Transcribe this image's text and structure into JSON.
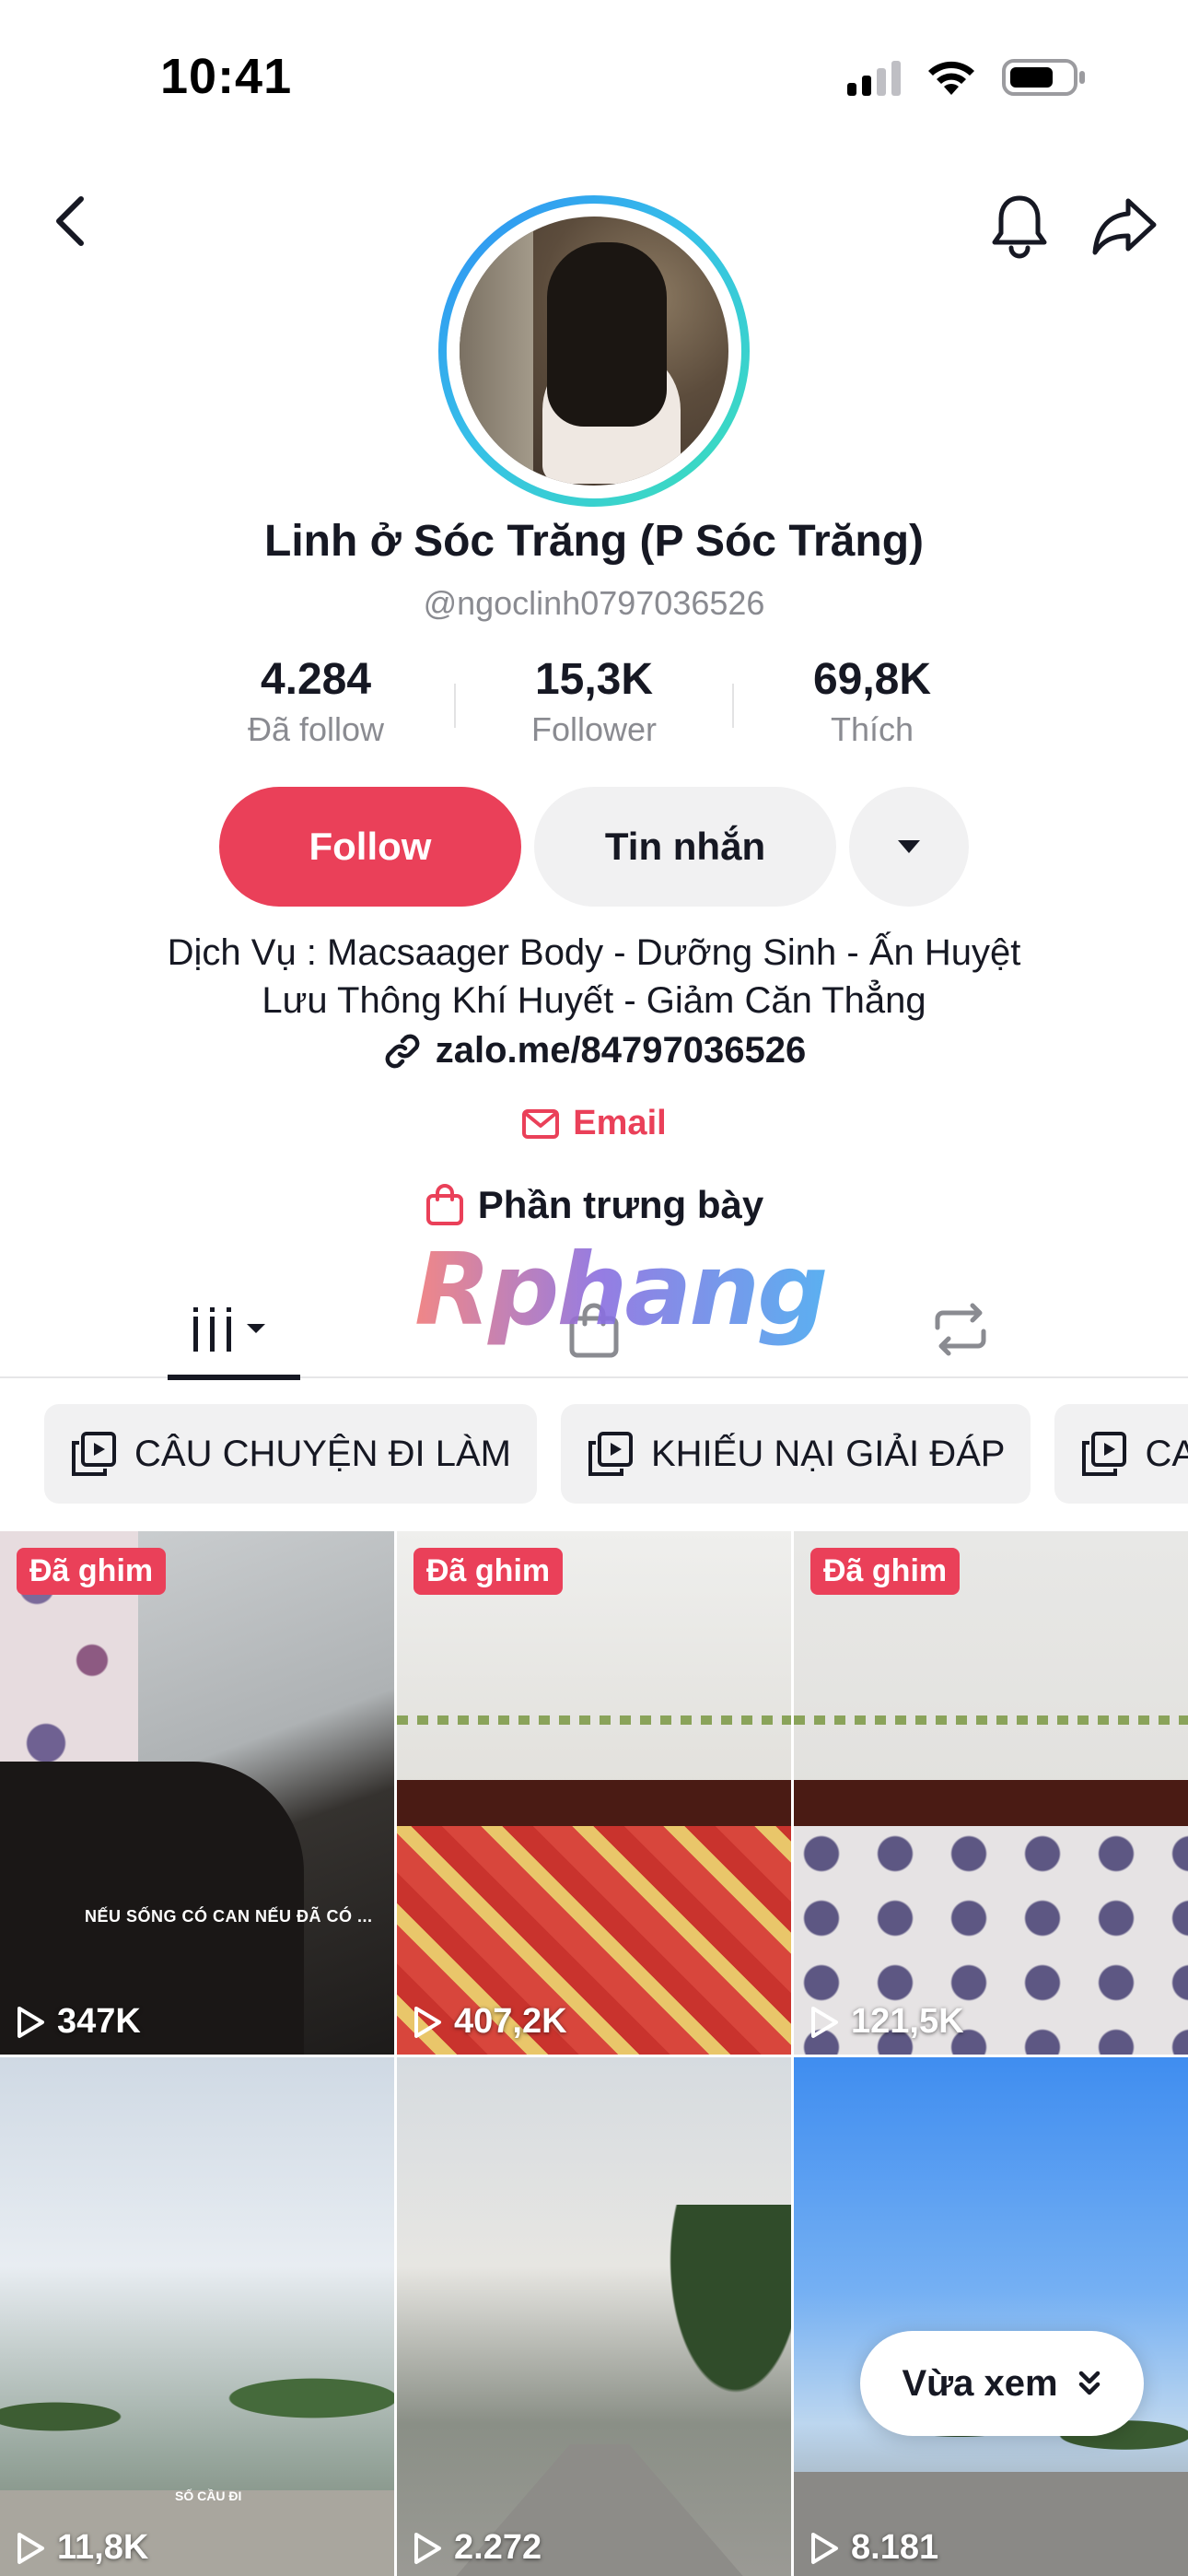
{
  "status_bar": {
    "time": "10:41"
  },
  "profile": {
    "display_name": "Linh ở Sóc Trăng (P Sóc Trăng)",
    "username": "@ngoclinh0797036526",
    "stats": [
      {
        "value": "4.284",
        "label": "Đã follow"
      },
      {
        "value": "15,3K",
        "label": "Follower"
      },
      {
        "value": "69,8K",
        "label": "Thích"
      }
    ],
    "buttons": {
      "follow": "Follow",
      "message": "Tin nhắn"
    },
    "bio_line1": "Dịch Vụ : Macsaager Body - Dưỡng Sinh - Ấn Huyệt",
    "bio_line2": "Lưu Thông Khí Huyết - Giảm Căn Thẳng",
    "link": "zalo.me/84797036526",
    "email": "Email",
    "showcase": "Phần trưng bày"
  },
  "watermark": "Rphang",
  "playlists": [
    {
      "label": "CÂU CHUYỆN ĐI LÀM"
    },
    {
      "label": "KHIẾU NẠI GIẢI ĐÁP"
    },
    {
      "label": "CA"
    }
  ],
  "videos": [
    {
      "pinned": "Đã ghim",
      "views": "347K",
      "caption": "NẾU SỐNG CÓ CAN NẾU ĐÃ CÓ ..."
    },
    {
      "pinned": "Đã ghim",
      "views": "407,2K"
    },
    {
      "pinned": "Đã ghim",
      "views": "121,5K"
    },
    {
      "views": "11,8K",
      "caption": "SỐ CẦU ĐI"
    },
    {
      "views": "2.272"
    },
    {
      "views": "8.181"
    }
  ],
  "recently_viewed": "Vừa xem",
  "colors": {
    "accent": "#ea4059",
    "text": "#161823",
    "muted": "#8a8b91",
    "chip_bg": "#f1f1f2"
  }
}
